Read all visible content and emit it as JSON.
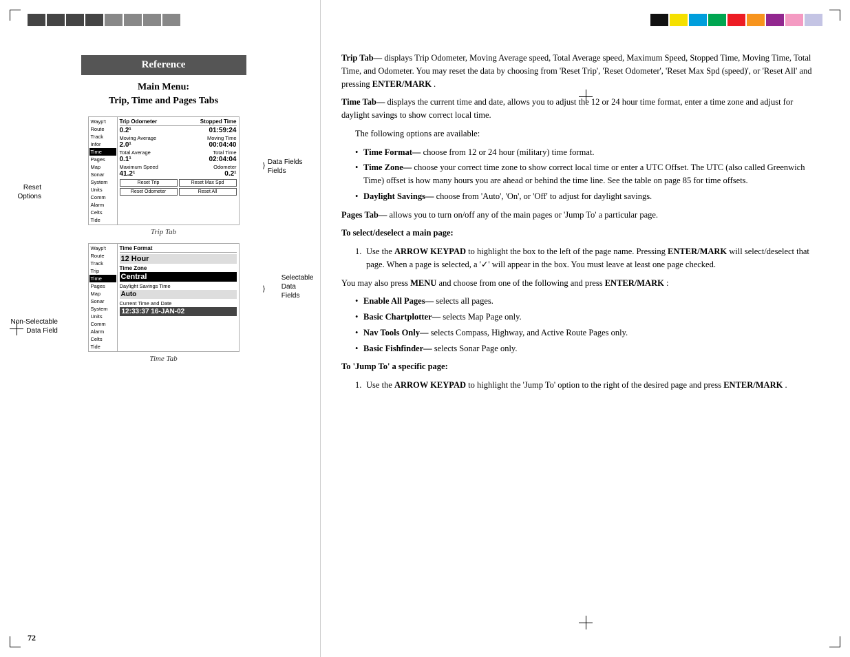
{
  "page": {
    "number": "72",
    "left_col": {
      "reference_label": "Reference",
      "main_menu_title": "Main Menu:",
      "main_menu_subtitle": "Trip, Time and Pages Tabs",
      "trip_tab_caption": "Trip Tab",
      "time_tab_caption": "Time Tab",
      "annotations": {
        "data_fields": "Data\nFields",
        "reset_options": "Reset\nOptions",
        "selectable_data_fields": "Selectable\nData\nFields",
        "non_selectable_data_field": "Non-Selectable\nData Field"
      }
    },
    "trip_tab": {
      "menu_items": [
        "Wayp't",
        "Route",
        "Track",
        "Infor",
        "Time",
        "Pages",
        "Map",
        "Sonar",
        "System",
        "Units",
        "Comm",
        "Alarm",
        "Celts",
        "Tide"
      ],
      "selected_item": "Time",
      "headers": [
        "Trip Odometer",
        "Stopped Time"
      ],
      "row1": {
        "label": "",
        "val1": "0.2¹",
        "val2": "01:59:24"
      },
      "row2": {
        "label": "Moving Average",
        "val1": "2.0¹",
        "label2": "Moving Time",
        "val2": "00:04:40"
      },
      "row3": {
        "label": "Total Average",
        "label2": "Total Time",
        "val1": "0.1¹",
        "val2": "02:04:04"
      },
      "row4": {
        "label": "Maximum Speed",
        "label2": "Odometer",
        "val1": "41.2¹",
        "val2": "0.2¹"
      },
      "buttons": [
        "Reset Trip",
        "Reset Max Spd"
      ],
      "bottom_button": "Reset Odometer",
      "bottom_button2": "Reset All"
    },
    "time_tab": {
      "menu_items": [
        "Wayp't",
        "Route",
        "Track",
        "Trip",
        "Time",
        "Pages",
        "Map",
        "Sonar",
        "System",
        "Units",
        "Comm",
        "Alarm",
        "Celts",
        "Tide"
      ],
      "selected_item": "Time",
      "rows": [
        {
          "label": "Time Format",
          "value": ""
        },
        {
          "label": "12 Hour",
          "value": ""
        },
        {
          "label": "Time Zone",
          "value": ""
        },
        {
          "label": "Central",
          "value": ""
        },
        {
          "label": "Daylight Savings Time",
          "value": ""
        },
        {
          "label": "Auto",
          "value": ""
        },
        {
          "label": "Current Time and Date",
          "value": ""
        },
        {
          "label": "12:33:37  16-JAN-02",
          "value": ""
        }
      ]
    },
    "right_col": {
      "trip_tab_paragraph": "Trip Tab— displays Trip Odometer, Moving Average speed, Total Average speed, Maximum Speed, Stopped Time, Moving Time, Total Time, and Odometer. You may reset the data by choosing from 'Reset Trip', 'Reset Odometer', 'Reset Max Spd (speed)', or 'Reset All' and pressing ENTER/MARK.",
      "trip_tab_bold": "Trip Tab—",
      "trip_tab_text": " displays Trip Odometer, Moving Average speed, Total Average speed, Maximum Speed, Stopped Time, Moving Time, Total Time, and Odometer. You may reset the data by choosing from 'Reset Trip', 'Reset Odometer', 'Reset Max Spd (speed)', or 'Reset All' and pressing ",
      "trip_tab_bold2": "ENTER/MARK",
      "trip_tab_end": ".",
      "time_tab_bold": "Time Tab—",
      "time_tab_text": " displays the current time and date, allows you to adjust the 12 or 24 hour time format, enter a time zone and adjust for daylight savings to show correct local time.",
      "following_options": "The following options are available:",
      "bullet1_bold": "Time Format—",
      "bullet1_text": " choose from 12 or 24 hour (military) time format.",
      "bullet2_bold": "Time Zone—",
      "bullet2_text": " choose your correct time zone to show correct local time or enter a UTC Offset. The UTC (also called Greenwich Time) offset is how many hours you are ahead or behind the time line. See the table on page 85 for time offsets.",
      "bullet3_bold": "Daylight Savings—",
      "bullet3_text": " choose from 'Auto', 'On', or 'Off' to adjust for daylight savings.",
      "pages_tab_bold": "Pages Tab—",
      "pages_tab_text": " allows you to turn on/off any of the main pages or 'Jump To' a particular page.",
      "heading_select": "To select/deselect a main page:",
      "step1_bold": "ARROW KEYPAD",
      "step1_text": " to highlight the box to the left of the page name. Pressing ",
      "step1_bold2": "ENTER/",
      "step1_bold3": "MARK",
      "step1_text2": " will select/deselect that page. When a page is selected, a '✓' will appear in the box. You must leave at least one page checked.",
      "step1_prefix": "Use the ",
      "also_press": "You may also press ",
      "menu_bold": "MENU",
      "also_text": " and choose from one of the following and press ",
      "enter_mark_bold": "ENTER/MARK",
      "also_end": ":",
      "enable_all_bold": "Enable All Pages—",
      "enable_all_text": " selects all pages.",
      "basic_chart_bold": "Basic Chartplotter—",
      "basic_chart_text": " selects Map Page only.",
      "nav_tools_bold": "Nav Tools Only—",
      "nav_tools_text": " selects Compass, Highway, and Active Route Pages only.",
      "basic_fish_bold": "Basic Fishfinder—",
      "basic_fish_text": " selects Sonar Page only.",
      "heading_jump": "To 'Jump To' a specific page:",
      "jump_step1_bold": "ARROW KEYPAD",
      "jump_step1_text": " to highlight the 'Jump To' option to the right of the desired page and press ",
      "jump_step1_bold2": "ENTER/MARK",
      "jump_step1_end": ".",
      "jump_step1_prefix": "Use the "
    }
  },
  "colors": {
    "color_bar_right": [
      "#000000",
      "#ffff00",
      "#00aaff",
      "#00cc00",
      "#ff0000",
      "#ff8800",
      "#cc00cc",
      "#ffaacc",
      "#aaaaff"
    ],
    "gray_bar_left": [
      "#555555",
      "#555555",
      "#555555",
      "#555555",
      "#999999",
      "#999999",
      "#999999",
      "#999999"
    ],
    "reference_bg": "#555555"
  }
}
